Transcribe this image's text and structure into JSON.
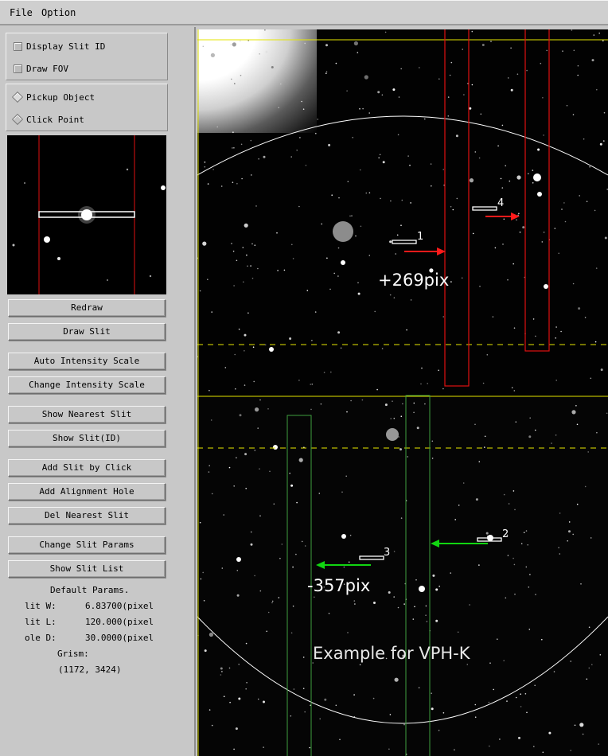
{
  "menubar": {
    "file": "File",
    "option": "Option"
  },
  "display": {
    "slit_id": "Display Slit ID",
    "fov": "Draw FOV"
  },
  "pick": {
    "object": "Pickup Object",
    "click": "Click Point",
    "selected": "object"
  },
  "buttons": {
    "redraw": "Redraw",
    "draw_slit": "Draw Slit",
    "auto_scale": "Auto Intensity Scale",
    "change_scale": "Change Intensity Scale",
    "nearest": "Show Nearest Slit",
    "show_id": "Show Slit(ID)",
    "add_click": "Add Slit by Click",
    "add_hole": "Add Alignment Hole",
    "del_nearest": "Del Nearest Slit",
    "change_params": "Change Slit Params",
    "list": "Show Slit List"
  },
  "params": {
    "heading": "Default Params.",
    "rows": [
      {
        "label": "lit W:",
        "value": "6.83700(pixel"
      },
      {
        "label": "lit L:",
        "value": "120.000(pixel"
      },
      {
        "label": "ole D:",
        "value": "30.0000(pixel"
      }
    ],
    "grism_label": "Grism:",
    "grism_value": "(1172, 3424)"
  },
  "view": {
    "shift_top": "+269pix",
    "shift_bottom": "-357pix",
    "caption": "Example for VPH-K",
    "slits": [
      {
        "id": "1"
      },
      {
        "id": "4"
      },
      {
        "id": "2"
      },
      {
        "id": "3"
      }
    ]
  },
  "colors": {
    "slit_top": "#e01010",
    "slit_bottom": "#3fa03f",
    "arrow_top": "#ff1a1a",
    "arrow_bottom": "#11d611",
    "fov": "#ffffff",
    "separator": "#e6e600"
  }
}
